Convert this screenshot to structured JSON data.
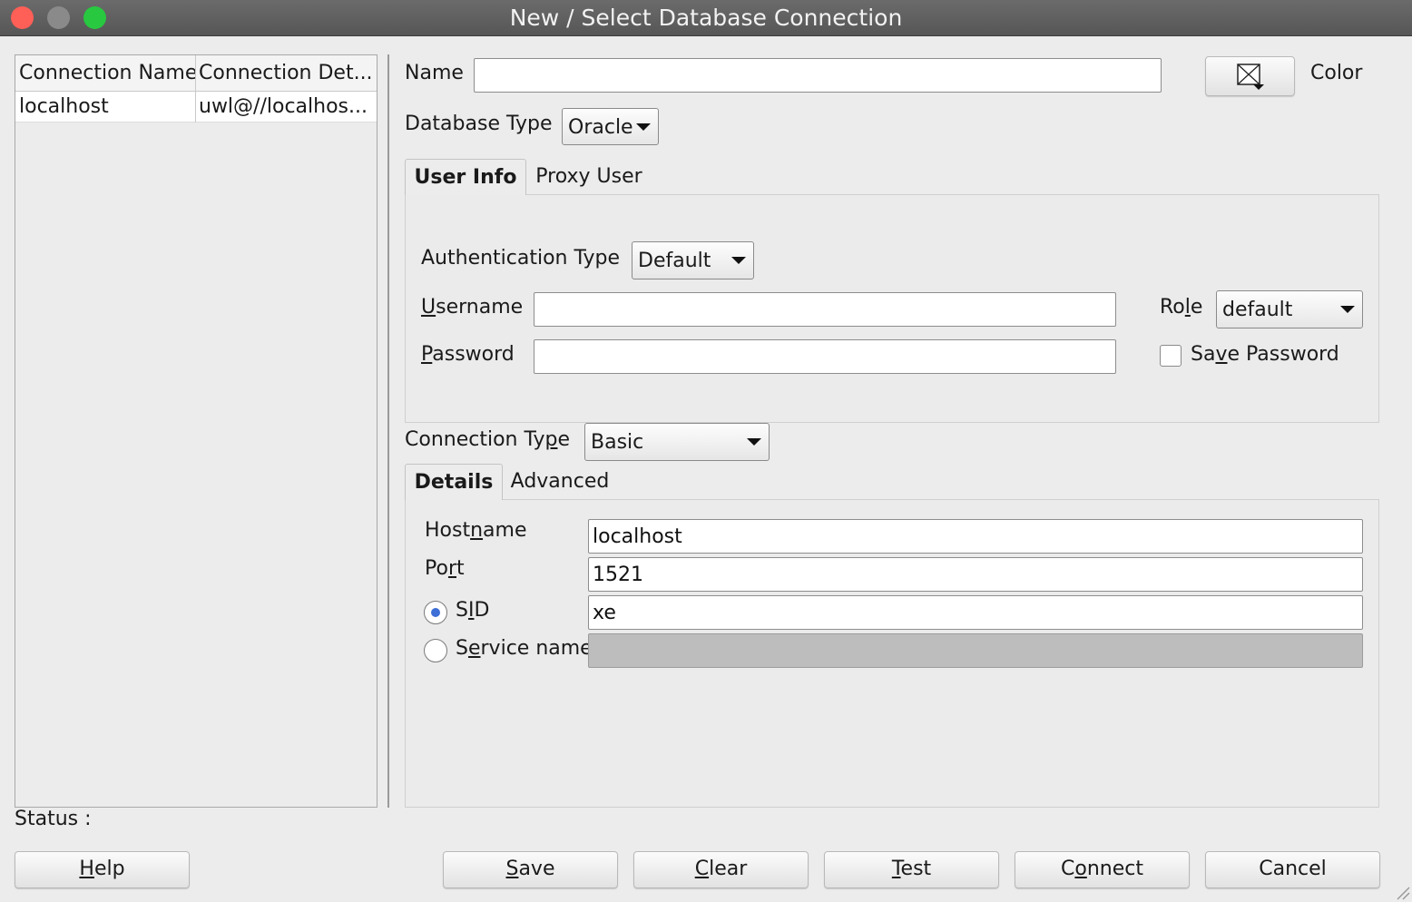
{
  "window": {
    "title": "New / Select Database Connection",
    "colors": {
      "close": "#fe5f57",
      "minimize": "#8a8a8a",
      "zoom": "#28c840"
    }
  },
  "connections": {
    "headers": [
      "Connection Name",
      "Connection Det..."
    ],
    "rows": [
      [
        "localhost",
        "uwl@//localhos..."
      ]
    ]
  },
  "form": {
    "name_label": "Name",
    "name_value": "",
    "color_label": "Color",
    "color_icon": "envelope-dropdown-icon",
    "database_type_label": "Database Type",
    "database_type_value": "Oracle"
  },
  "user_tabs": {
    "active": "User Info",
    "inactive": "Proxy User"
  },
  "user_info": {
    "auth_type_label": "Authentication Type",
    "auth_type_value": "Default",
    "username_label": "Username",
    "username_mnemonic": "U",
    "username_rest": "sername",
    "username_value": "",
    "password_label": "Password",
    "password_mnemonic": "P",
    "password_rest": "assword",
    "password_value": "",
    "role_label": "Role",
    "role_pre": "Ro",
    "role_mnemonic": "l",
    "role_post": "e",
    "role_value": "default",
    "save_password_pre": "Sa",
    "save_password_mnemonic": "v",
    "save_password_post": "e Password",
    "save_password_checked": false
  },
  "connection_type": {
    "label_pre": "Connection Ty",
    "label_mnemonic": "p",
    "label_post": "e",
    "value": "Basic"
  },
  "detail_tabs": {
    "active": "Details",
    "inactive": "Advanced"
  },
  "details": {
    "hostname_pre": "Host",
    "hostname_mnemonic": "n",
    "hostname_post": "ame",
    "hostname_value": "localhost",
    "port_pre": "Po",
    "port_mnemonic": "r",
    "port_post": "t",
    "port_value": "1521",
    "sid_pre": "S",
    "sid_mnemonic": "I",
    "sid_post": "D",
    "sid_value": "xe",
    "sid_selected": true,
    "service_pre": "S",
    "service_mnemonic": "e",
    "service_post": "rvice name",
    "service_value": ""
  },
  "status": {
    "label": "Status :"
  },
  "buttons": {
    "help_mnemonic": "H",
    "help_rest": "elp",
    "save_mnemonic": "S",
    "save_rest": "ave",
    "clear_mnemonic": "C",
    "clear_rest": "lear",
    "test_mnemonic": "T",
    "test_rest": "est",
    "connect_pre": "C",
    "connect_mnemonic": "o",
    "connect_post": "nnect",
    "cancel": "Cancel"
  }
}
